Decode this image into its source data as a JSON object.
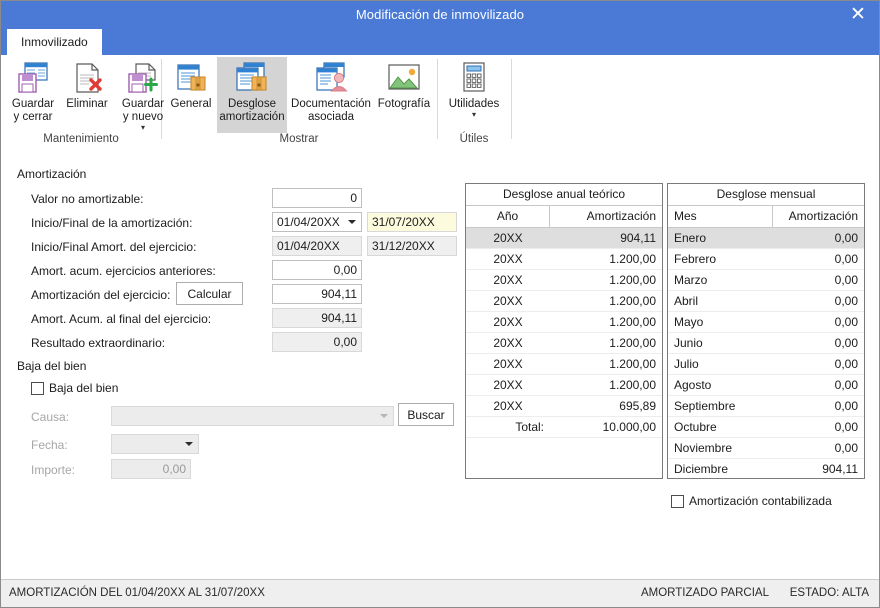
{
  "window": {
    "title": "Modificación de inmovilizado",
    "close_label": "✕",
    "tab_label": "Inmovilizado",
    "titlebar_color": "#4a7ad6"
  },
  "ribbon": {
    "groups": [
      {
        "label": "Mantenimiento"
      },
      {
        "label": "Mostrar"
      },
      {
        "label": "Útiles"
      }
    ],
    "buttons": [
      {
        "id": "guardar-y-cerrar",
        "label": "Guardar\ny cerrar",
        "icon": "save-close-icon",
        "active": false,
        "caret": false
      },
      {
        "id": "eliminar",
        "label": "Eliminar",
        "icon": "delete-document-icon",
        "active": false,
        "caret": false
      },
      {
        "id": "guardar-y-nuevo",
        "label": "Guardar\ny nuevo",
        "icon": "save-new-icon",
        "active": false,
        "caret": true
      },
      {
        "id": "general",
        "label": "General",
        "icon": "general-document-icon",
        "active": false,
        "caret": false
      },
      {
        "id": "desglose-amortizacion",
        "label": "Desglose\namortización",
        "icon": "breakdown-icon",
        "active": true,
        "caret": false
      },
      {
        "id": "documentacion-asociada",
        "label": "Documentación\nasociada",
        "icon": "documentation-icon",
        "active": false,
        "caret": false
      },
      {
        "id": "fotografia",
        "label": "Fotografía",
        "icon": "photo-icon",
        "active": false,
        "caret": false
      },
      {
        "id": "utilidades",
        "label": "Utilidades",
        "icon": "calculator-icon",
        "active": false,
        "caret": true
      }
    ]
  },
  "form": {
    "section_amortizacion": "Amortización",
    "section_baja": "Baja del bien",
    "labels": {
      "valor_no_amortizable": "Valor no amortizable:",
      "inicio_final_amortizacion": "Inicio/Final de la amortización:",
      "inicio_final_ejercicio": "Inicio/Final Amort. del ejercicio:",
      "amort_acum_anteriores": "Amort. acum. ejercicios anteriores:",
      "amortizacion_ejercicio": "Amortización del ejercicio:",
      "amort_acum_final": "Amort. Acum. al final del ejercicio:",
      "resultado_extraordinario": "Resultado extraordinario:",
      "causa": "Causa:",
      "fecha": "Fecha:",
      "importe": "Importe:"
    },
    "values": {
      "valor_no_amortizable": "0",
      "inicio_amortizacion": "01/04/20XX",
      "final_amortizacion": "31/07/20XX",
      "inicio_ejercicio": "01/04/20XX",
      "final_ejercicio": "31/12/20XX",
      "amort_acum_anteriores": "0,00",
      "amortizacion_ejercicio": "904,11",
      "amort_acum_final": "904,11",
      "resultado_extraordinario": "0,00",
      "causa": "",
      "fecha": "",
      "importe": "0,00"
    },
    "buttons": {
      "calcular": "Calcular",
      "buscar": "Buscar"
    },
    "checkboxes": {
      "baja_del_bien": "Baja del bien",
      "amortizacion_contabilizada": "Amortización contabilizada"
    }
  },
  "tables": {
    "annual": {
      "title": "Desglose anual teórico",
      "columns": [
        "Año",
        "Amortización"
      ],
      "rows": [
        {
          "c1": "20XX",
          "c2": "904,11",
          "selected": true
        },
        {
          "c1": "20XX",
          "c2": "1.200,00",
          "selected": false
        },
        {
          "c1": "20XX",
          "c2": "1.200,00",
          "selected": false
        },
        {
          "c1": "20XX",
          "c2": "1.200,00",
          "selected": false
        },
        {
          "c1": "20XX",
          "c2": "1.200,00",
          "selected": false
        },
        {
          "c1": "20XX",
          "c2": "1.200,00",
          "selected": false
        },
        {
          "c1": "20XX",
          "c2": "1.200,00",
          "selected": false
        },
        {
          "c1": "20XX",
          "c2": "1.200,00",
          "selected": false
        },
        {
          "c1": "20XX",
          "c2": "695,89",
          "selected": false
        },
        {
          "c1": "Total:",
          "c2": "10.000,00",
          "selected": false,
          "total": true
        }
      ]
    },
    "monthly": {
      "title": "Desglose mensual",
      "columns": [
        "Mes",
        "Amortización"
      ],
      "rows": [
        {
          "c1": "Enero",
          "c2": "0,00",
          "selected": true
        },
        {
          "c1": "Febrero",
          "c2": "0,00",
          "selected": false
        },
        {
          "c1": "Marzo",
          "c2": "0,00",
          "selected": false
        },
        {
          "c1": "Abril",
          "c2": "0,00",
          "selected": false
        },
        {
          "c1": "Mayo",
          "c2": "0,00",
          "selected": false
        },
        {
          "c1": "Junio",
          "c2": "0,00",
          "selected": false
        },
        {
          "c1": "Julio",
          "c2": "0,00",
          "selected": false
        },
        {
          "c1": "Agosto",
          "c2": "0,00",
          "selected": false
        },
        {
          "c1": "Septiembre",
          "c2": "0,00",
          "selected": false
        },
        {
          "c1": "Octubre",
          "c2": "0,00",
          "selected": false
        },
        {
          "c1": "Noviembre",
          "c2": "0,00",
          "selected": false
        },
        {
          "c1": "Diciembre",
          "c2": "904,11",
          "selected": false
        }
      ]
    }
  },
  "statusbar": {
    "left": "AMORTIZACIÓN DEL 01/04/20XX AL 31/07/20XX",
    "right_1": "AMORTIZADO PARCIAL",
    "right_2": "ESTADO: ALTA"
  }
}
